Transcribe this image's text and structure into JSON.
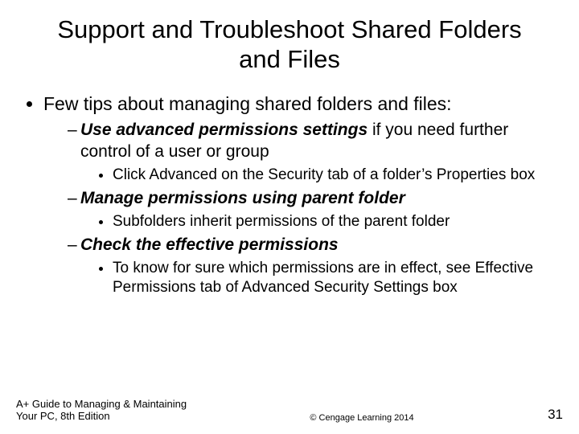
{
  "title": "Support and Troubleshoot Shared Folders and Files",
  "bullet1": "Few tips about managing shared folders and files:",
  "tip1_emph": "Use advanced permissions settings",
  "tip1_rest": " if you need further control of a user or group",
  "tip1_sub": "Click Advanced on the Security tab of a folder’s Properties box",
  "tip2_emph": "Manage permissions using parent folder",
  "tip2_sub": "Subfolders inherit permissions of the parent folder",
  "tip3_emph": "Check the effective permissions",
  "tip3_sub": "To know for sure which permissions are in effect, see Effective Permissions tab of Advanced Security Settings box",
  "footer_left": "A+ Guide to Managing & Maintaining Your PC, 8th Edition",
  "footer_center": "© Cengage Learning 2014",
  "footer_right": "31"
}
